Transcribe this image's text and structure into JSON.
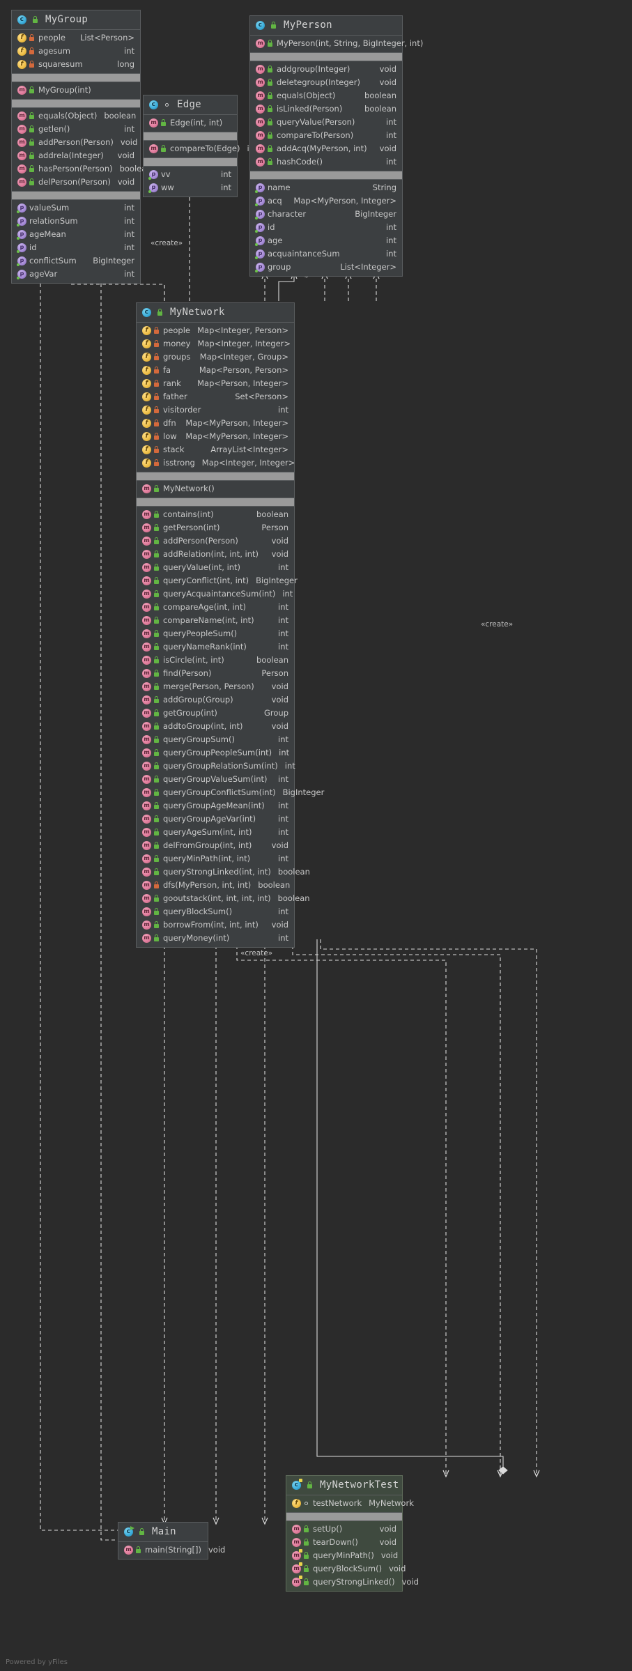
{
  "footer": "Powered by yFiles",
  "edge_labels": {
    "create_left": "«create»",
    "create_right": "«create»",
    "create_bottom": "«create»",
    "star": "*",
    "one": "1"
  },
  "classes": {
    "mygroup": {
      "name": "MyGroup",
      "icon": "class-icon",
      "visibility": "public",
      "fields": [
        {
          "name": "people",
          "type": "List<Person>",
          "icon": "field-icon",
          "visibility": "private"
        },
        {
          "name": "agesum",
          "type": "int",
          "icon": "field-icon",
          "visibility": "private"
        },
        {
          "name": "squaresum",
          "type": "long",
          "icon": "field-icon",
          "visibility": "private"
        }
      ],
      "constructors": [
        {
          "name": "MyGroup(int)",
          "type": "",
          "icon": "method-icon",
          "visibility": "public"
        }
      ],
      "methods": [
        {
          "name": "equals(Object)",
          "type": "boolean",
          "icon": "method-icon",
          "visibility": "public"
        },
        {
          "name": "getlen()",
          "type": "int",
          "icon": "method-icon",
          "visibility": "public"
        },
        {
          "name": "addPerson(Person)",
          "type": "void",
          "icon": "method-icon",
          "visibility": "public"
        },
        {
          "name": "addrela(Integer)",
          "type": "void",
          "icon": "method-icon",
          "visibility": "public"
        },
        {
          "name": "hasPerson(Person)",
          "type": "boolean",
          "icon": "method-icon",
          "visibility": "public"
        },
        {
          "name": "delPerson(Person)",
          "type": "void",
          "icon": "method-icon",
          "visibility": "public"
        }
      ],
      "properties": [
        {
          "name": "valueSum",
          "type": "int",
          "icon": "property-icon"
        },
        {
          "name": "relationSum",
          "type": "int",
          "icon": "property-icon"
        },
        {
          "name": "ageMean",
          "type": "int",
          "icon": "property-icon"
        },
        {
          "name": "id",
          "type": "int",
          "icon": "property-icon"
        },
        {
          "name": "conflictSum",
          "type": "BigInteger",
          "icon": "property-icon"
        },
        {
          "name": "ageVar",
          "type": "int",
          "icon": "property-icon"
        }
      ]
    },
    "edge": {
      "name": "Edge",
      "icon": "class-icon",
      "visibility": "package",
      "constructors": [
        {
          "name": "Edge(int, int)",
          "type": "",
          "icon": "method-icon",
          "visibility": "public"
        }
      ],
      "methods": [
        {
          "name": "compareTo(Edge)",
          "type": "int",
          "icon": "method-icon",
          "visibility": "public"
        }
      ],
      "properties": [
        {
          "name": "vv",
          "type": "int",
          "icon": "property-icon"
        },
        {
          "name": "ww",
          "type": "int",
          "icon": "property-icon"
        }
      ]
    },
    "myperson": {
      "name": "MyPerson",
      "icon": "class-icon",
      "visibility": "public",
      "constructors": [
        {
          "name": "MyPerson(int, String, BigInteger, int)",
          "type": "",
          "icon": "method-icon",
          "visibility": "public"
        }
      ],
      "methods": [
        {
          "name": "addgroup(Integer)",
          "type": "void",
          "icon": "method-icon",
          "visibility": "public"
        },
        {
          "name": "deletegroup(Integer)",
          "type": "void",
          "icon": "method-icon",
          "visibility": "public"
        },
        {
          "name": "equals(Object)",
          "type": "boolean",
          "icon": "method-icon",
          "visibility": "public"
        },
        {
          "name": "isLinked(Person)",
          "type": "boolean",
          "icon": "method-icon",
          "visibility": "public"
        },
        {
          "name": "queryValue(Person)",
          "type": "int",
          "icon": "method-icon",
          "visibility": "public"
        },
        {
          "name": "compareTo(Person)",
          "type": "int",
          "icon": "method-icon",
          "visibility": "public"
        },
        {
          "name": "addAcq(MyPerson, int)",
          "type": "void",
          "icon": "method-icon",
          "visibility": "public"
        },
        {
          "name": "hashCode()",
          "type": "int",
          "icon": "method-icon",
          "visibility": "public"
        }
      ],
      "properties": [
        {
          "name": "name",
          "type": "String",
          "icon": "property-icon"
        },
        {
          "name": "acq",
          "type": "Map<MyPerson, Integer>",
          "icon": "property-icon"
        },
        {
          "name": "character",
          "type": "BigInteger",
          "icon": "property-icon"
        },
        {
          "name": "id",
          "type": "int",
          "icon": "property-icon"
        },
        {
          "name": "age",
          "type": "int",
          "icon": "property-icon"
        },
        {
          "name": "acquaintanceSum",
          "type": "int",
          "icon": "property-icon"
        },
        {
          "name": "group",
          "type": "List<Integer>",
          "icon": "property-icon"
        }
      ]
    },
    "mynetwork": {
      "name": "MyNetwork",
      "icon": "class-icon",
      "visibility": "public",
      "fields": [
        {
          "name": "people",
          "type": "Map<Integer, Person>",
          "icon": "field-icon",
          "visibility": "private"
        },
        {
          "name": "money",
          "type": "Map<Integer, Integer>",
          "icon": "field-icon",
          "visibility": "private"
        },
        {
          "name": "groups",
          "type": "Map<Integer, Group>",
          "icon": "field-icon",
          "visibility": "private"
        },
        {
          "name": "fa",
          "type": "Map<Person, Person>",
          "icon": "field-icon",
          "visibility": "private"
        },
        {
          "name": "rank",
          "type": "Map<Person, Integer>",
          "icon": "field-icon",
          "visibility": "private"
        },
        {
          "name": "father",
          "type": "Set<Person>",
          "icon": "field-icon",
          "visibility": "private"
        },
        {
          "name": "visitorder",
          "type": "int",
          "icon": "field-icon",
          "visibility": "private"
        },
        {
          "name": "dfn",
          "type": "Map<MyPerson, Integer>",
          "icon": "field-icon",
          "visibility": "private"
        },
        {
          "name": "low",
          "type": "Map<MyPerson, Integer>",
          "icon": "field-icon",
          "visibility": "private"
        },
        {
          "name": "stack",
          "type": "ArrayList<Integer>",
          "icon": "field-icon",
          "visibility": "private"
        },
        {
          "name": "isstrong",
          "type": "Map<Integer, Integer>",
          "icon": "field-icon",
          "visibility": "private"
        }
      ],
      "constructors": [
        {
          "name": "MyNetwork()",
          "type": "",
          "icon": "method-icon",
          "visibility": "public"
        }
      ],
      "methods": [
        {
          "name": "contains(int)",
          "type": "boolean",
          "icon": "method-icon",
          "visibility": "public"
        },
        {
          "name": "getPerson(int)",
          "type": "Person",
          "icon": "method-icon",
          "visibility": "public"
        },
        {
          "name": "addPerson(Person)",
          "type": "void",
          "icon": "method-icon",
          "visibility": "public"
        },
        {
          "name": "addRelation(int, int, int)",
          "type": "void",
          "icon": "method-icon",
          "visibility": "public"
        },
        {
          "name": "queryValue(int, int)",
          "type": "int",
          "icon": "method-icon",
          "visibility": "public"
        },
        {
          "name": "queryConflict(int, int)",
          "type": "BigInteger",
          "icon": "method-icon",
          "visibility": "public"
        },
        {
          "name": "queryAcquaintanceSum(int)",
          "type": "int",
          "icon": "method-icon",
          "visibility": "public"
        },
        {
          "name": "compareAge(int, int)",
          "type": "int",
          "icon": "method-icon",
          "visibility": "public"
        },
        {
          "name": "compareName(int, int)",
          "type": "int",
          "icon": "method-icon",
          "visibility": "public"
        },
        {
          "name": "queryPeopleSum()",
          "type": "int",
          "icon": "method-icon",
          "visibility": "public"
        },
        {
          "name": "queryNameRank(int)",
          "type": "int",
          "icon": "method-icon",
          "visibility": "public"
        },
        {
          "name": "isCircle(int, int)",
          "type": "boolean",
          "icon": "method-icon",
          "visibility": "public"
        },
        {
          "name": "find(Person)",
          "type": "Person",
          "icon": "method-icon",
          "visibility": "public"
        },
        {
          "name": "merge(Person, Person)",
          "type": "void",
          "icon": "method-icon",
          "visibility": "public"
        },
        {
          "name": "addGroup(Group)",
          "type": "void",
          "icon": "method-icon",
          "visibility": "public"
        },
        {
          "name": "getGroup(int)",
          "type": "Group",
          "icon": "method-icon",
          "visibility": "public"
        },
        {
          "name": "addtoGroup(int, int)",
          "type": "void",
          "icon": "method-icon",
          "visibility": "public"
        },
        {
          "name": "queryGroupSum()",
          "type": "int",
          "icon": "method-icon",
          "visibility": "public"
        },
        {
          "name": "queryGroupPeopleSum(int)",
          "type": "int",
          "icon": "method-icon",
          "visibility": "public"
        },
        {
          "name": "queryGroupRelationSum(int)",
          "type": "int",
          "icon": "method-icon",
          "visibility": "public"
        },
        {
          "name": "queryGroupValueSum(int)",
          "type": "int",
          "icon": "method-icon",
          "visibility": "public"
        },
        {
          "name": "queryGroupConflictSum(int)",
          "type": "BigInteger",
          "icon": "method-icon",
          "visibility": "public"
        },
        {
          "name": "queryGroupAgeMean(int)",
          "type": "int",
          "icon": "method-icon",
          "visibility": "public"
        },
        {
          "name": "queryGroupAgeVar(int)",
          "type": "int",
          "icon": "method-icon",
          "visibility": "public"
        },
        {
          "name": "queryAgeSum(int, int)",
          "type": "int",
          "icon": "method-icon",
          "visibility": "public"
        },
        {
          "name": "delFromGroup(int, int)",
          "type": "void",
          "icon": "method-icon",
          "visibility": "public"
        },
        {
          "name": "queryMinPath(int, int)",
          "type": "int",
          "icon": "method-icon",
          "visibility": "public"
        },
        {
          "name": "queryStrongLinked(int, int)",
          "type": "boolean",
          "icon": "method-icon",
          "visibility": "public"
        },
        {
          "name": "dfs(MyPerson, int, int)",
          "type": "boolean",
          "icon": "method-icon",
          "visibility": "private"
        },
        {
          "name": "gooutstack(int, int, int, int)",
          "type": "boolean",
          "icon": "method-icon",
          "visibility": "public"
        },
        {
          "name": "queryBlockSum()",
          "type": "int",
          "icon": "method-icon",
          "visibility": "public"
        },
        {
          "name": "borrowFrom(int, int, int)",
          "type": "void",
          "icon": "method-icon",
          "visibility": "public"
        },
        {
          "name": "queryMoney(int)",
          "type": "int",
          "icon": "method-icon",
          "visibility": "public"
        }
      ]
    },
    "main": {
      "name": "Main",
      "icon": "runnable-class-icon",
      "visibility": "public",
      "methods": [
        {
          "name": "main(String[])",
          "type": "void",
          "icon": "method-icon",
          "visibility": "public"
        }
      ]
    },
    "mynetworktest": {
      "name": "MyNetworkTest",
      "icon": "test-class-icon",
      "visibility": "public",
      "fields": [
        {
          "name": "testNetwork",
          "type": "MyNetwork",
          "icon": "field-icon",
          "visibility": "package"
        }
      ],
      "methods": [
        {
          "name": "setUp()",
          "type": "void",
          "icon": "test-method-icon",
          "visibility": "public"
        },
        {
          "name": "tearDown()",
          "type": "void",
          "icon": "test-method-icon",
          "visibility": "public"
        },
        {
          "name": "queryMinPath()",
          "type": "void",
          "icon": "test-method-icon",
          "visibility": "public"
        },
        {
          "name": "queryBlockSum()",
          "type": "void",
          "icon": "test-method-icon",
          "visibility": "public"
        },
        {
          "name": "queryStrongLinked()",
          "type": "void",
          "icon": "test-method-icon",
          "visibility": "public"
        }
      ]
    }
  }
}
